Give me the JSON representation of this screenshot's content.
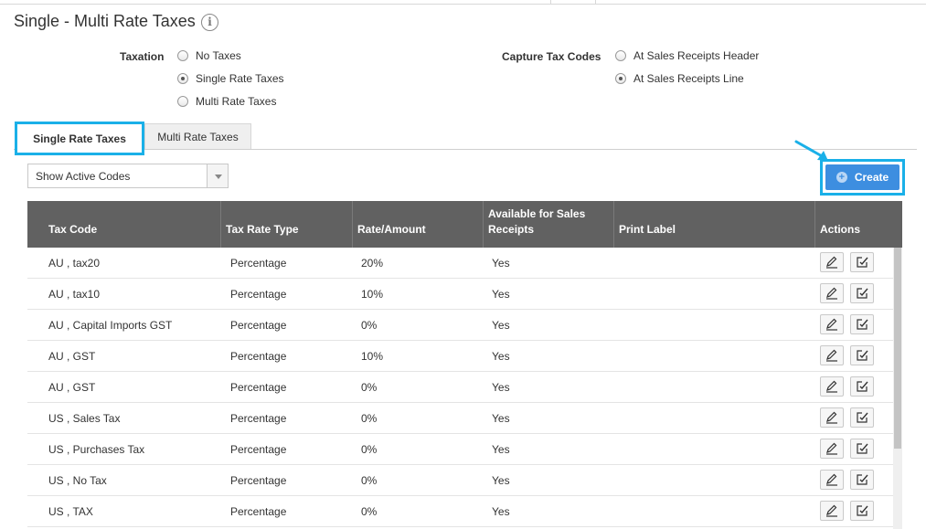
{
  "page": {
    "title": "Single - Multi Rate Taxes",
    "info_icon": "info-icon",
    "info_glyph": "i"
  },
  "taxation": {
    "label": "Taxation",
    "options": [
      {
        "label": "No Taxes",
        "checked": false
      },
      {
        "label": "Single Rate Taxes",
        "checked": true
      },
      {
        "label": "Multi Rate Taxes",
        "checked": false
      }
    ]
  },
  "capture": {
    "label": "Capture Tax Codes",
    "options": [
      {
        "label": "At Sales Receipts Header",
        "checked": false
      },
      {
        "label": "At Sales Receipts Line",
        "checked": true
      }
    ]
  },
  "tabs": [
    {
      "label": "Single Rate Taxes",
      "active": true
    },
    {
      "label": "Multi Rate Taxes",
      "active": false
    }
  ],
  "filter": {
    "selected": "Show Active Codes"
  },
  "create": {
    "label": "Create",
    "icon": "plus-circle-icon"
  },
  "colors": {
    "accent_highlight": "#1ab0e8",
    "button_blue": "#3d8ee0",
    "header_gray": "#616161"
  },
  "table": {
    "headers": [
      "Tax Code",
      "Tax Rate Type",
      "Rate/Amount",
      "Available for Sales Receipts",
      "Print Label",
      "Actions"
    ],
    "rows": [
      {
        "code": "AU , tax20",
        "type": "Percentage",
        "rate": "20%",
        "available": "Yes",
        "label": ""
      },
      {
        "code": "AU , tax10",
        "type": "Percentage",
        "rate": "10%",
        "available": "Yes",
        "label": ""
      },
      {
        "code": "AU , Capital Imports GST",
        "type": "Percentage",
        "rate": "0%",
        "available": "Yes",
        "label": ""
      },
      {
        "code": "AU , GST",
        "type": "Percentage",
        "rate": "10%",
        "available": "Yes",
        "label": ""
      },
      {
        "code": "AU , GST",
        "type": "Percentage",
        "rate": "0%",
        "available": "Yes",
        "label": ""
      },
      {
        "code": "US , Sales Tax",
        "type": "Percentage",
        "rate": "0%",
        "available": "Yes",
        "label": ""
      },
      {
        "code": "US , Purchases Tax",
        "type": "Percentage",
        "rate": "0%",
        "available": "Yes",
        "label": ""
      },
      {
        "code": "US , No Tax",
        "type": "Percentage",
        "rate": "0%",
        "available": "Yes",
        "label": ""
      },
      {
        "code": "US , TAX",
        "type": "Percentage",
        "rate": "0%",
        "available": "Yes",
        "label": ""
      }
    ],
    "row_actions": [
      "edit-pencil-icon",
      "edit-box-icon"
    ]
  }
}
